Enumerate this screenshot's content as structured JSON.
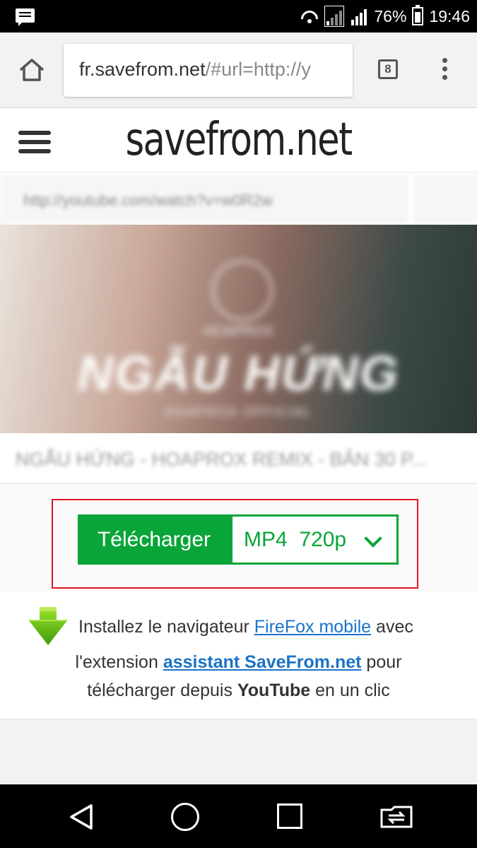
{
  "status_bar": {
    "battery": "76%",
    "time": "19:46",
    "sim1": "1",
    "sim2": "2"
  },
  "browser": {
    "url_host": "fr.savefrom.net",
    "url_rest": "/#url=http://y",
    "tab_count": "8"
  },
  "site": {
    "logo": "savefrom.net",
    "input_placeholder_blurred": "http://youtube.com/watch?v=w0R2w",
    "thumbnail_title": "NGẪU HỨNG",
    "thumbnail_small": "HOAPROX",
    "thumbnail_sub": "HOAPROX OFFICIAL",
    "video_title_blurred": "NGẪU HỨNG - HOAPROX REMIX - BẢN 30 P..."
  },
  "download": {
    "button_label": "Télécharger",
    "format_value": "MP4  720p"
  },
  "promo": {
    "line1_prefix": "Installez le navigateur ",
    "line1_link": "FireFox mobile",
    "line1_suffix": " avec",
    "line2_prefix": "l'extension ",
    "line2_link": "assistant SaveFrom.net",
    "line2_suffix": " pour",
    "line3_prefix": "télécharger depuis ",
    "line3_bold": "YouTube",
    "line3_suffix": " en un clic"
  },
  "colors": {
    "accent_green": "#0aa538",
    "highlight_red": "#e0141e",
    "link_blue": "#1a73c8"
  }
}
